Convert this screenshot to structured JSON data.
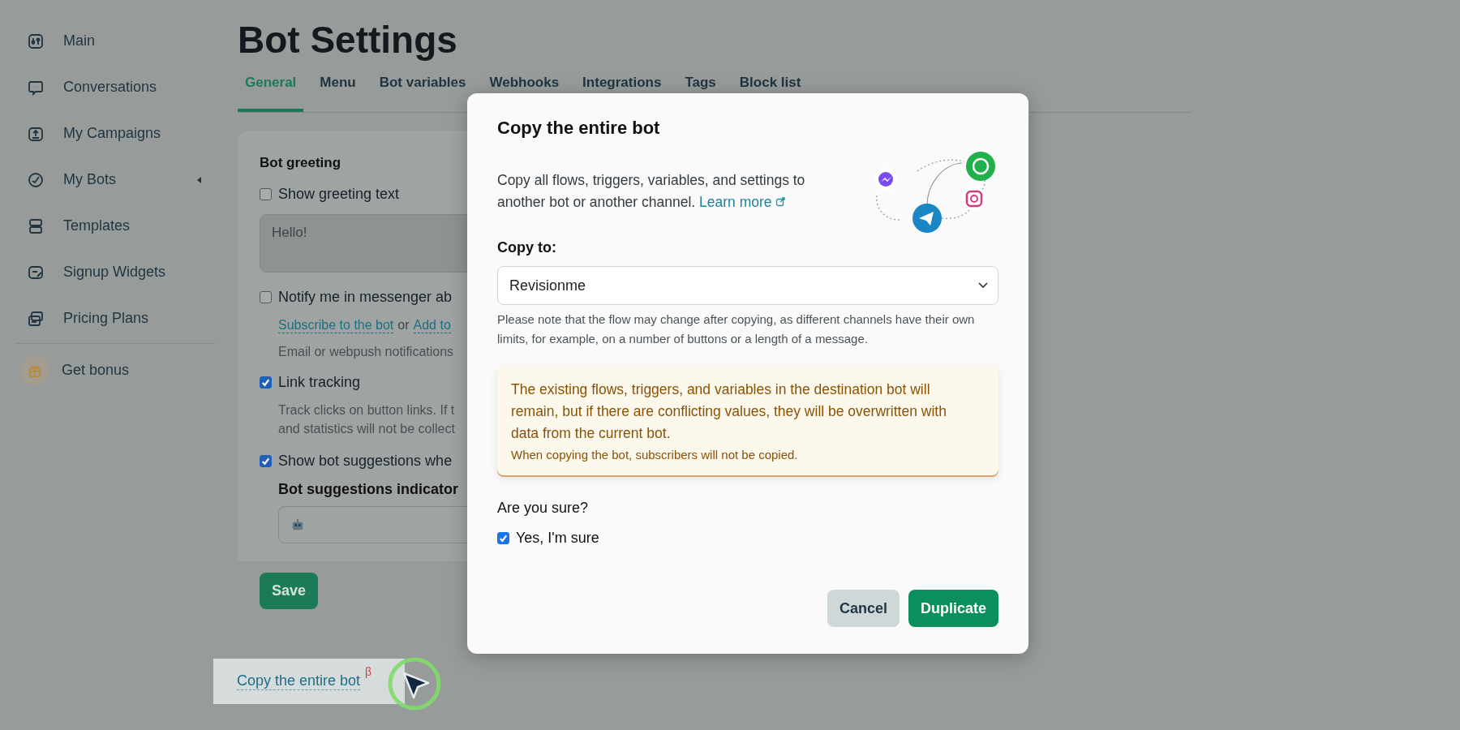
{
  "sidebar": {
    "items": [
      {
        "label": "Main",
        "has_submenu": false
      },
      {
        "label": "Conversations",
        "has_submenu": false
      },
      {
        "label": "My Campaigns",
        "has_submenu": false
      },
      {
        "label": "My Bots",
        "has_submenu": true
      },
      {
        "label": "Templates",
        "has_submenu": false
      },
      {
        "label": "Signup Widgets",
        "has_submenu": false
      },
      {
        "label": "Pricing Plans",
        "has_submenu": false
      }
    ],
    "bonus": {
      "label": "Get bonus"
    }
  },
  "page": {
    "title": "Bot Settings",
    "tabs": [
      {
        "label": "General",
        "selected": true
      },
      {
        "label": "Menu",
        "selected": false
      },
      {
        "label": "Bot variables",
        "selected": false
      },
      {
        "label": "Webhooks",
        "selected": false
      },
      {
        "label": "Integrations",
        "selected": false
      },
      {
        "label": "Tags",
        "selected": false
      },
      {
        "label": "Block list",
        "selected": false
      }
    ]
  },
  "settings": {
    "section_title": "Bot greeting",
    "show_greeting": {
      "label": "Show greeting text",
      "checked": false
    },
    "greeting_text": "Hello!",
    "notify": {
      "label": "Notify me in messenger ab",
      "checked": false
    },
    "subscribe_link": "Subscribe to the bot",
    "or_text": "or",
    "add_link": "Add to",
    "notify_hint": "Email or webpush notifications",
    "link_tracking": {
      "label": "Link tracking",
      "checked": true,
      "hint_lines": [
        "Track clicks on button links. If t",
        "and statistics will not be collect"
      ]
    },
    "suggestions": {
      "label": "Show bot suggestions whe",
      "checked": true
    },
    "indicator_title": "Bot suggestions indicator",
    "save_button": "Save"
  },
  "copy_link": {
    "label": "Copy the entire bot",
    "badge": "β"
  },
  "dialog": {
    "title": "Copy the entire bot",
    "description": "Copy all flows, triggers, variables, and settings to another bot or another channel.",
    "learn_more": "Learn more",
    "copy_to_label": "Copy to:",
    "select_value": "Revisionme",
    "note": "Please note that the flow may change after copying, as different channels have their own limits, for example, on a number of buttons or a length of a message.",
    "warning": {
      "main": "The existing flows, triggers, and variables in the destination bot will remain, but if there are conflicting values, they will be overwritten with data from the current bot.",
      "sub": "When copying the bot, subscribers will not be copied."
    },
    "question": "Are you sure?",
    "confirm": {
      "label": "Yes, I'm sure",
      "checked": true
    },
    "buttons": [
      {
        "label": "Cancel",
        "kind": "secondary"
      },
      {
        "label": "Duplicate",
        "kind": "primary"
      }
    ]
  }
}
